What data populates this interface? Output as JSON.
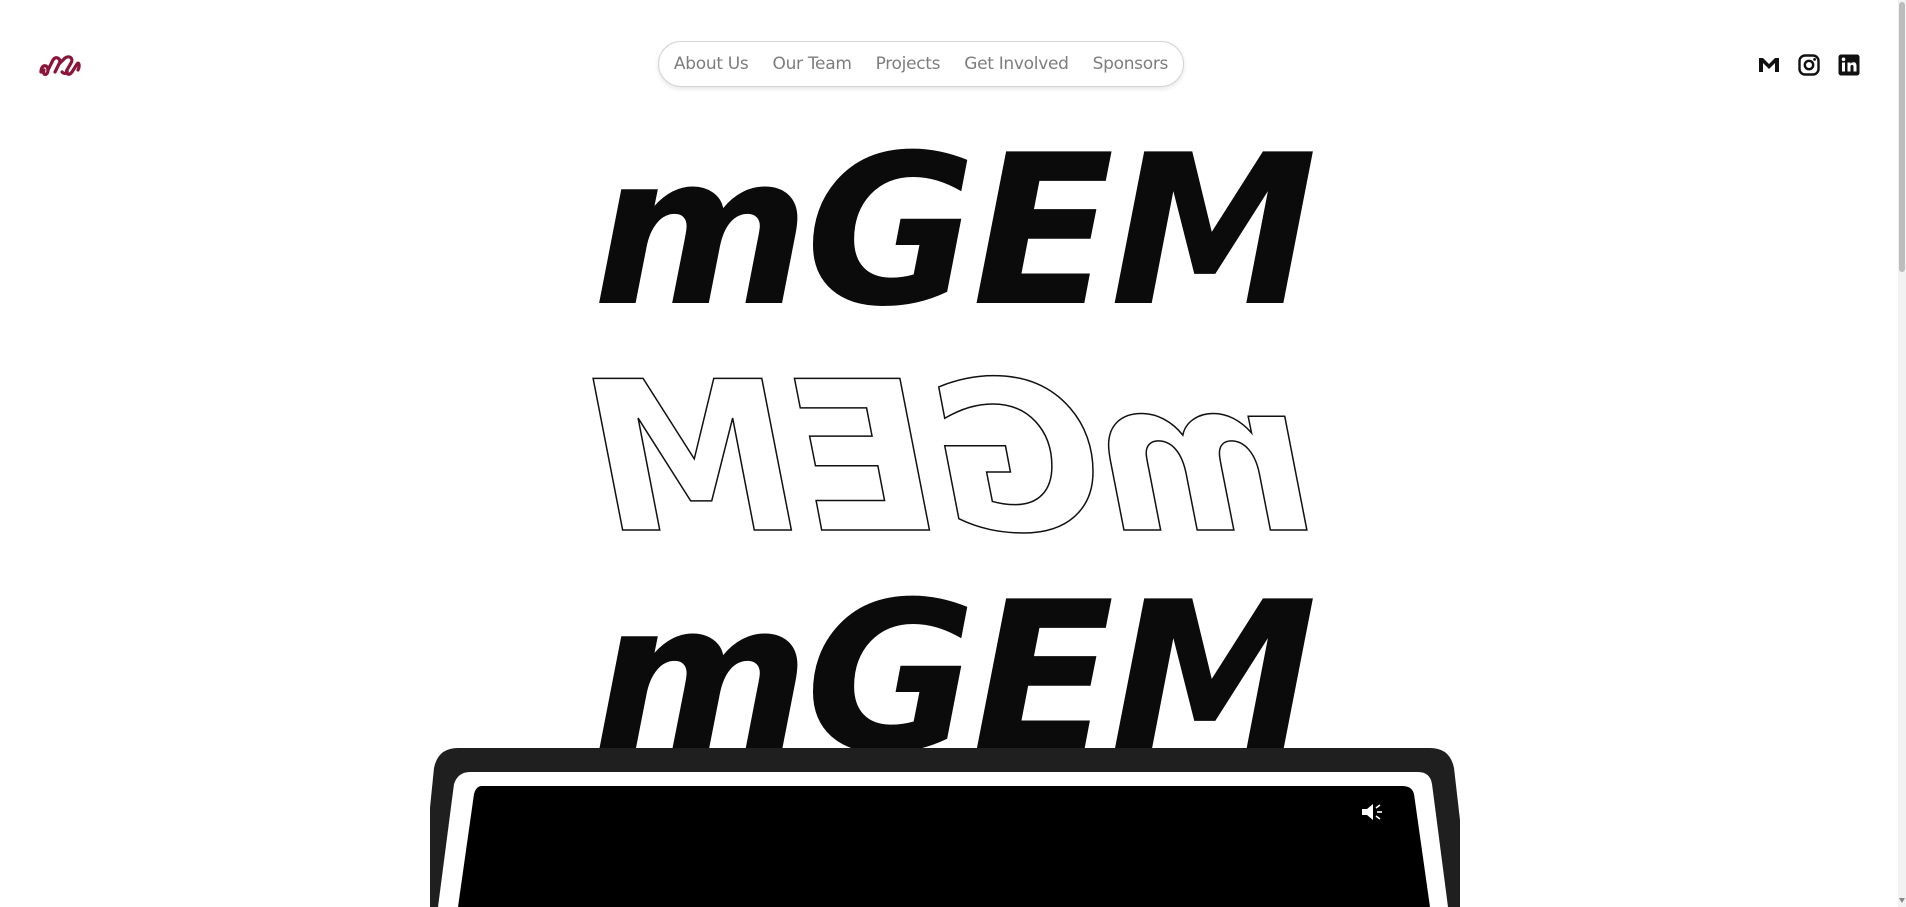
{
  "brand": {
    "logo_icon": "mgem-logo-icon",
    "accent_color": "#8a1538"
  },
  "nav": {
    "items": [
      {
        "label": "About Us"
      },
      {
        "label": "Our Team"
      },
      {
        "label": "Projects"
      },
      {
        "label": "Get Involved"
      },
      {
        "label": "Sponsors"
      }
    ]
  },
  "social": [
    {
      "icon": "gmail-icon"
    },
    {
      "icon": "instagram-icon"
    },
    {
      "icon": "linkedin-icon"
    }
  ],
  "hero": {
    "line1": "mGEM",
    "line2": "mGEM",
    "line3": "mGEM"
  },
  "video": {
    "sound_icon": "speaker-muted-icon",
    "screen_color": "#000000",
    "frame_color": "#222222"
  }
}
